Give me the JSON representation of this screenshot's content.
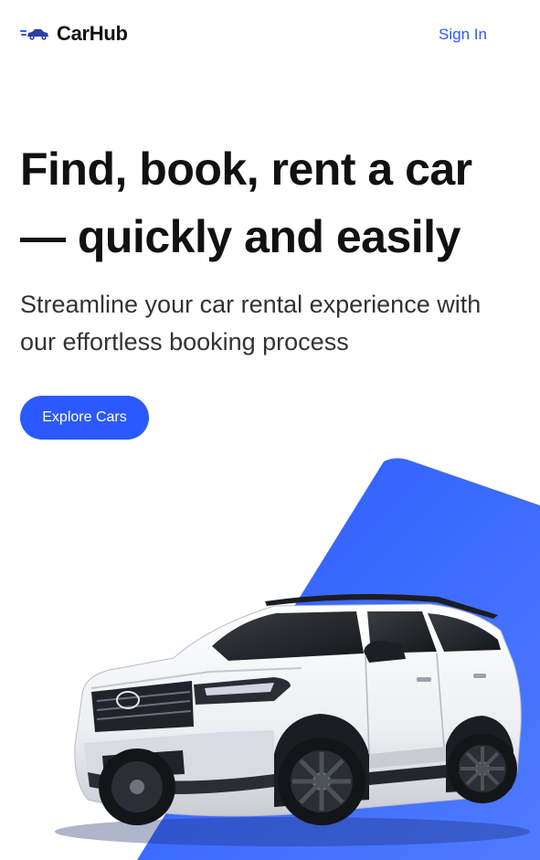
{
  "navbar": {
    "logo_text": "CarHub",
    "logo_icon": "car-speed-icon",
    "signin_label": "Sign In"
  },
  "hero": {
    "title_line1": "Find, book, rent a car",
    "title_line2": "— quickly and easily",
    "subtitle_line1": "Streamline your car rental experience with",
    "subtitle_line2": "our effortless booking process",
    "cta_label": "Explore Cars",
    "car_image": "white-suv-image"
  },
  "colors": {
    "accent": "#2B59FF",
    "text": "#111111",
    "background": "#FFFFFF"
  }
}
